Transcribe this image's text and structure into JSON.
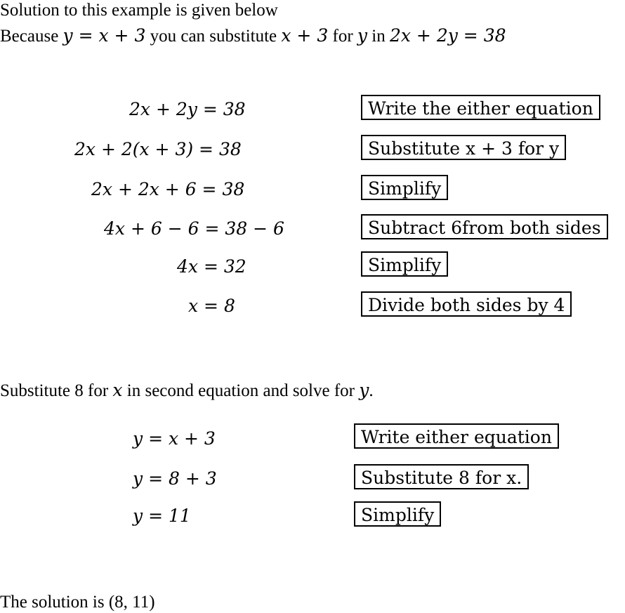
{
  "intro": {
    "line1": "Solution to this example is given below",
    "line2_parts": [
      "Because ",
      "y = x + 3",
      " you can substitute ",
      "x + 3",
      " for ",
      "y",
      " in ",
      "2x + 2y = 38"
    ]
  },
  "part1": {
    "steps": [
      {
        "equation": "2x + 2y = 38",
        "note": "Write the either equation"
      },
      {
        "equation": "2x + 2(x + 3) = 38",
        "note": "Substitute x + 3 for y"
      },
      {
        "equation": "2x + 2x + 6 = 38",
        "note": "Simplify"
      },
      {
        "equation": "4x + 6 − 6 = 38 − 6",
        "note": "Subtract 6from both sides"
      },
      {
        "equation": "4x = 32",
        "note": "Simplify"
      },
      {
        "equation": "x = 8",
        "note": "Divide both sides by 4"
      }
    ]
  },
  "part2": {
    "heading_parts": [
      "Substitute 8 for ",
      "x",
      " in second equation and solve for ",
      "y",
      "."
    ],
    "steps": [
      {
        "equation": "y = x + 3",
        "note": "Write either equation"
      },
      {
        "equation": "y = 8 + 3",
        "note": "Substitute 8 for x."
      },
      {
        "equation": "y = 11",
        "note": "Simplify"
      }
    ]
  },
  "conclusion": {
    "text": "The solution is ",
    "answer": "(8, 11)"
  }
}
